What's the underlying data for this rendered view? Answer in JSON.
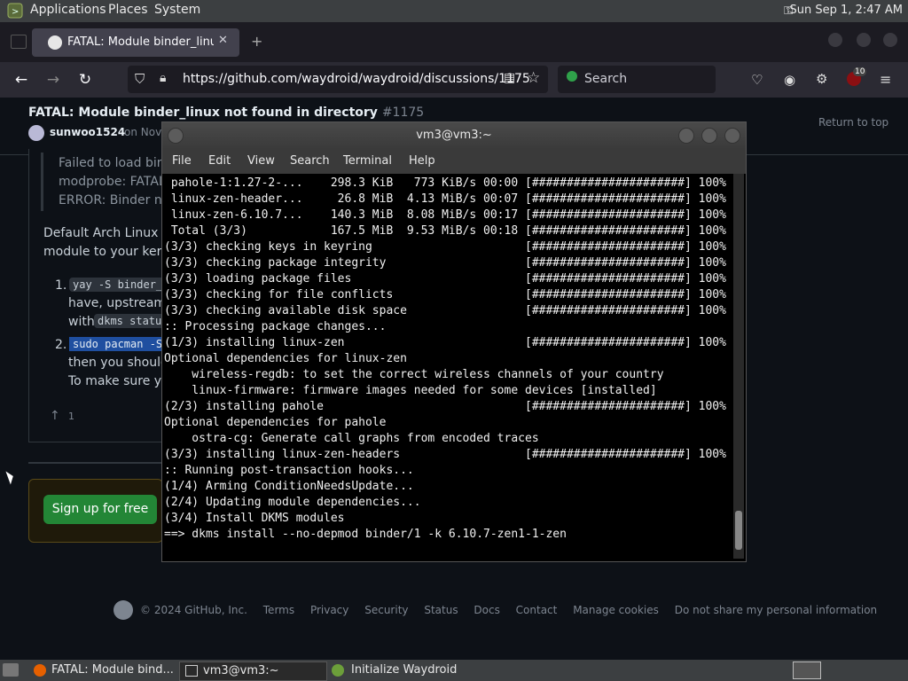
{
  "top_panel": {
    "menus": [
      "Applications",
      "Places",
      "System"
    ],
    "clock": "Sun Sep  1,  2:47 AM"
  },
  "browser": {
    "tab_title": "FATAL: Module binder_linux",
    "url": "https://github.com/waydroid/waydroid/discussions/1175",
    "search_placeholder": "Search",
    "extension_badge": "10"
  },
  "github": {
    "title": "FATAL: Module binder_linux not found in directory",
    "number": "#1175",
    "author": "sunwoo1524",
    "date": "on Nov",
    "return_to_top": "Return to top",
    "quote_lines": [
      "Failed to load binde",
      "modprobe: FATAL:",
      "ERROR: Binder no"
    ],
    "para_lines": [
      "Default Arch Linux ke",
      "module to your kernel"
    ],
    "list": {
      "item1_num": "1.",
      "item1_code": "yay -S binder_",
      "item1_line2": "have, upstream li",
      "item1_line3_prefix": "with",
      "item1_code2": "dkms statu",
      "item2_num": "2.",
      "item2_code": "sudo pacman -S",
      "item2_line2": "then you should r",
      "item2_line3": "To make sure you"
    },
    "upvote_count": "1",
    "signup_label": "Sign up for free",
    "footer": [
      "© 2024 GitHub, Inc.",
      "Terms",
      "Privacy",
      "Security",
      "Status",
      "Docs",
      "Contact",
      "Manage cookies",
      "Do not share my personal information"
    ]
  },
  "terminal": {
    "title": "vm3@vm3:~",
    "menus": [
      "File",
      "Edit",
      "View",
      "Search",
      "Terminal",
      "Help"
    ],
    "lines": [
      " pahole-1:1.27-2-...    298.3 KiB   773 KiB/s 00:00 [######################] 100%",
      " linux-zen-header...     26.8 MiB  4.13 MiB/s 00:07 [######################] 100%",
      " linux-zen-6.10.7...    140.3 MiB  8.08 MiB/s 00:17 [######################] 100%",
      " Total (3/3)            167.5 MiB  9.53 MiB/s 00:18 [######################] 100%",
      "(3/3) checking keys in keyring                      [######################] 100%",
      "(3/3) checking package integrity                    [######################] 100%",
      "(3/3) loading package files                         [######################] 100%",
      "(3/3) checking for file conflicts                   [######################] 100%",
      "(3/3) checking available disk space                 [######################] 100%",
      ":: Processing package changes...",
      "(1/3) installing linux-zen                          [######################] 100%",
      "Optional dependencies for linux-zen",
      "    wireless-regdb: to set the correct wireless channels of your country",
      "    linux-firmware: firmware images needed for some devices [installed]",
      "(2/3) installing pahole                             [######################] 100%",
      "Optional dependencies for pahole",
      "    ostra-cg: Generate call graphs from encoded traces",
      "(3/3) installing linux-zen-headers                  [######################] 100%",
      ":: Running post-transaction hooks...",
      "(1/4) Arming ConditionNeedsUpdate...",
      "(2/4) Updating module dependencies...",
      "(3/4) Install DKMS modules",
      "==> dkms install --no-depmod binder/1 -k 6.10.7-zen1-1-zen"
    ]
  },
  "taskbar": {
    "items": [
      "FATAL: Module bind...",
      "vm3@vm3:~",
      "Initialize Waydroid"
    ]
  }
}
